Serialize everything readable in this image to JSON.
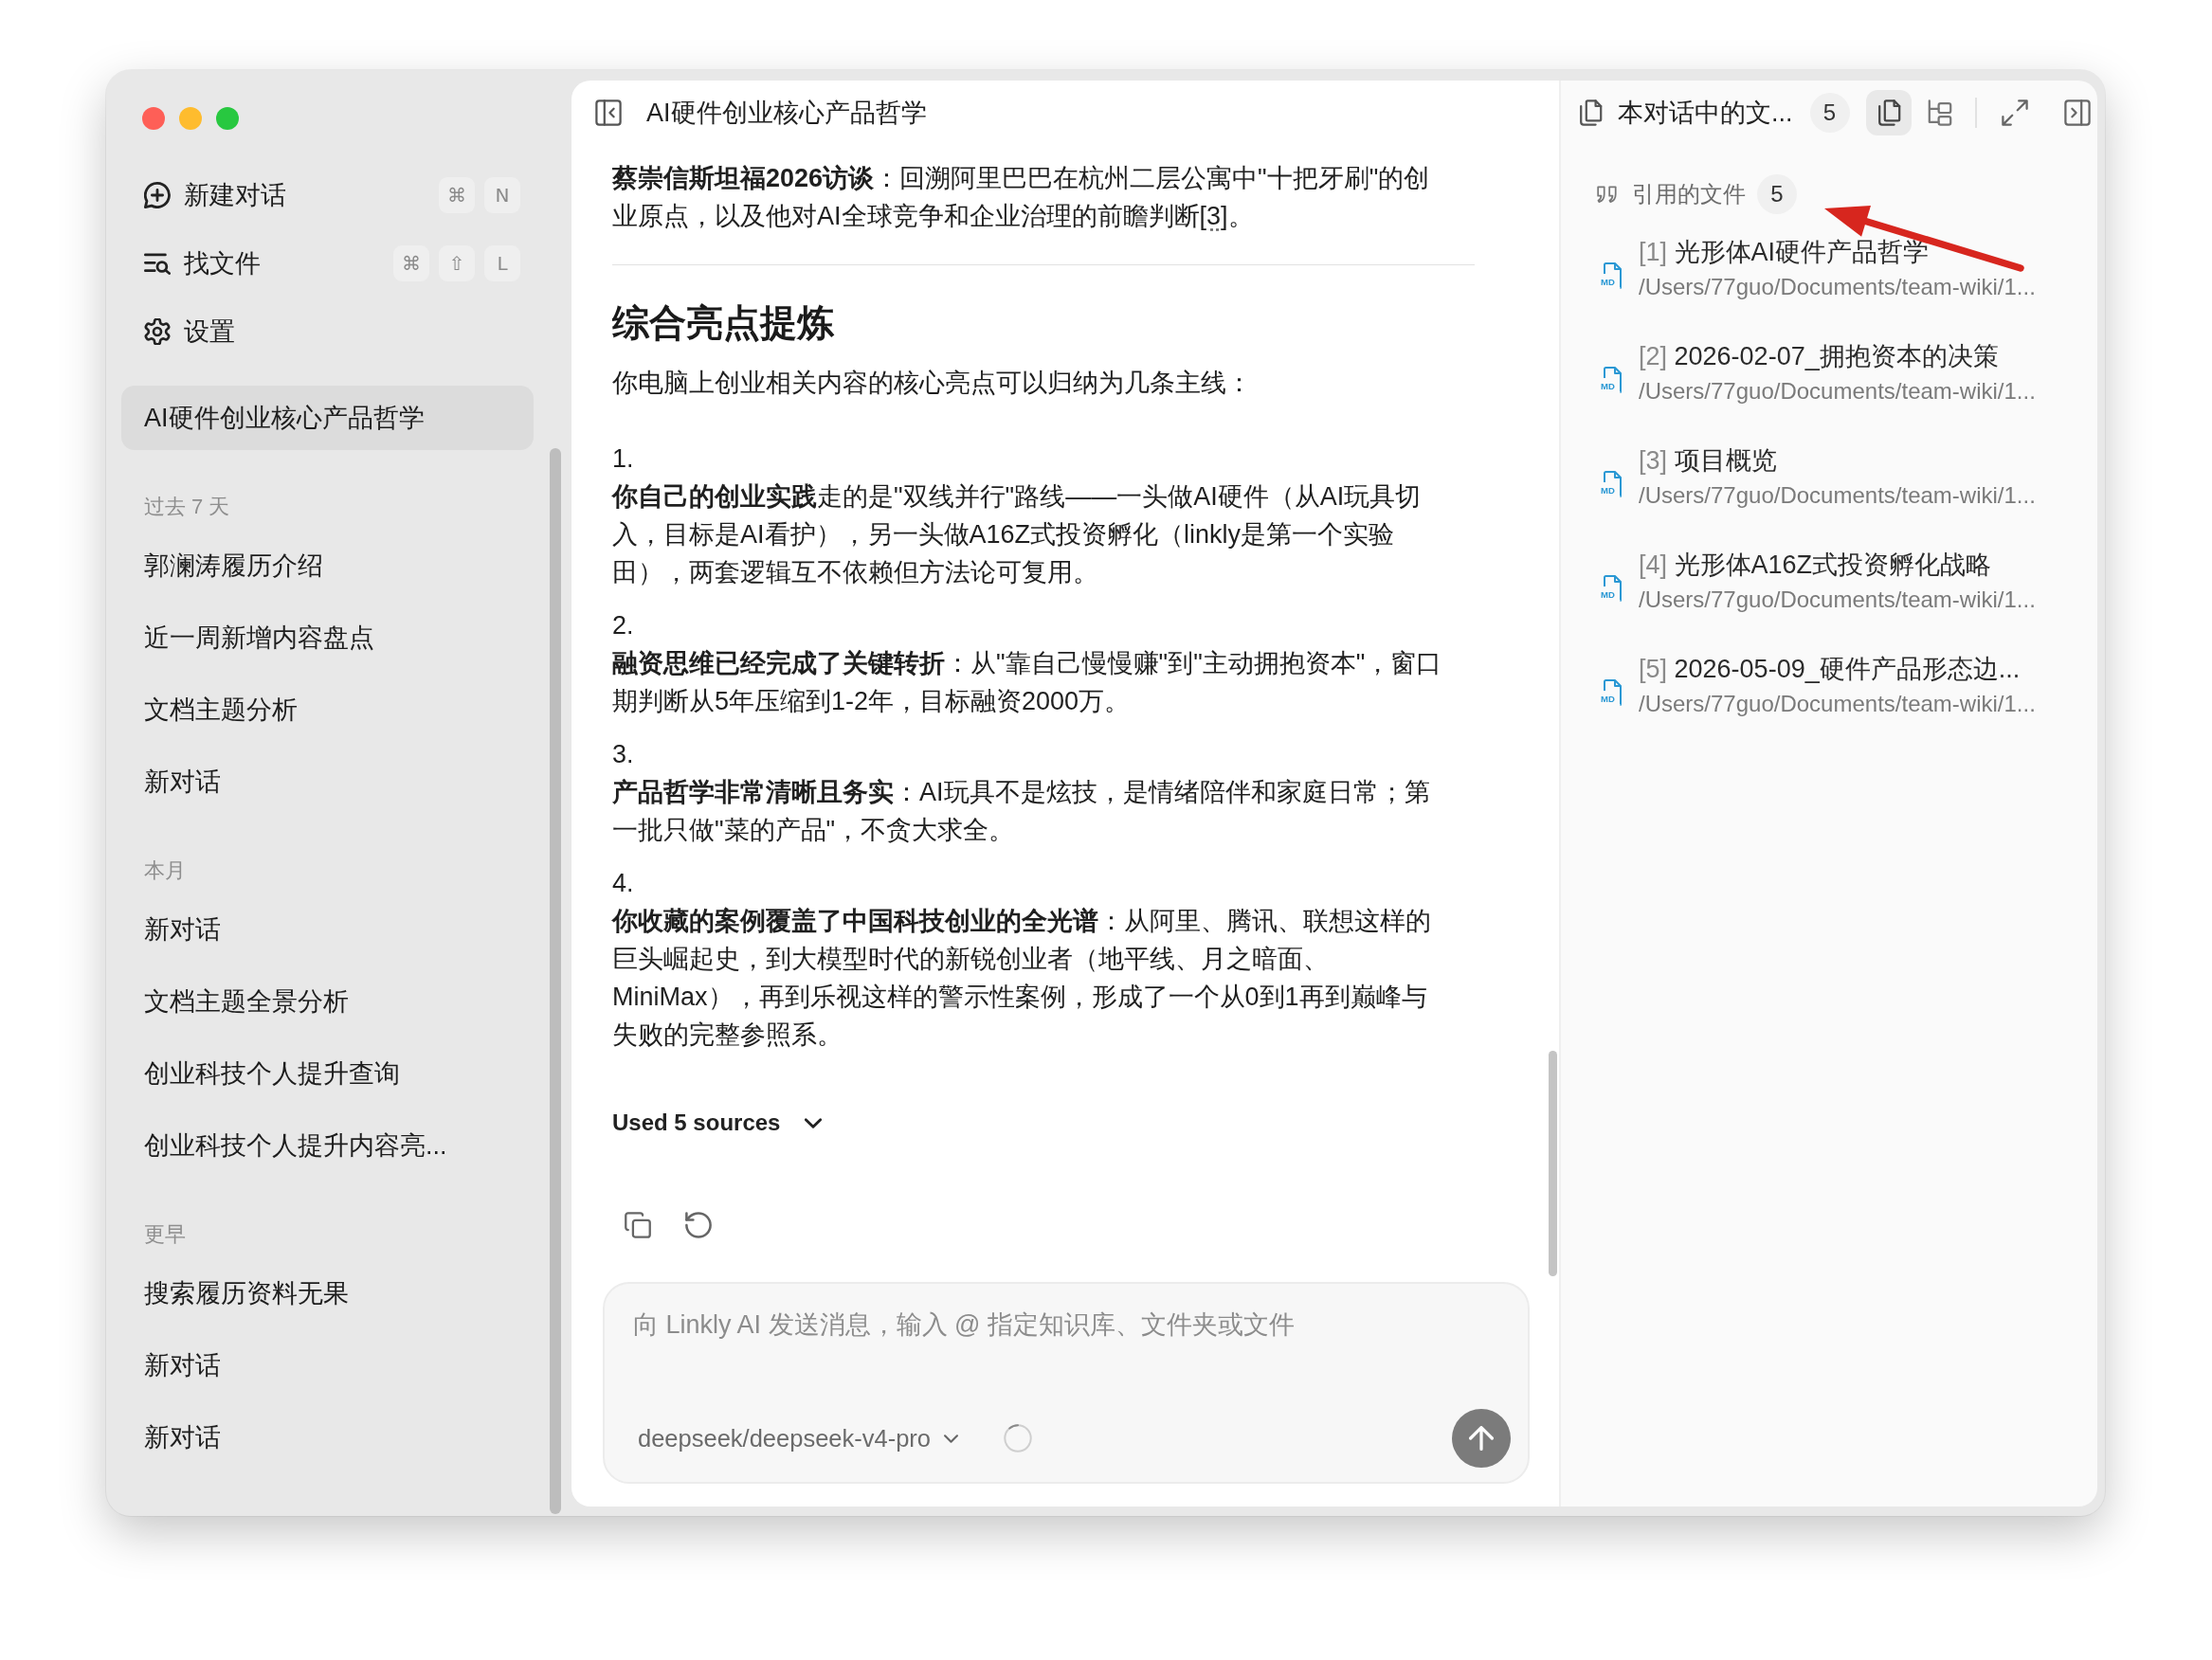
{
  "sidebar": {
    "actions": [
      {
        "kind": "new-chat",
        "label": "新建对话",
        "keys": [
          "⌘",
          "N"
        ]
      },
      {
        "kind": "find-files",
        "label": "找文件",
        "keys": [
          "⌘",
          "⇧",
          "L"
        ]
      },
      {
        "kind": "settings",
        "label": "设置"
      }
    ],
    "groups": [
      {
        "items": [
          {
            "title": "AI硬件创业核心产品哲学",
            "selected": true
          }
        ]
      },
      {
        "heading": "过去 7 天",
        "items": [
          {
            "title": "郭澜涛履历介绍",
            "selected": false
          },
          {
            "title": "近一周新增内容盘点",
            "selected": false
          },
          {
            "title": "文档主题分析",
            "selected": false
          },
          {
            "title": "新对话",
            "selected": false
          }
        ]
      },
      {
        "heading": "本月",
        "items": [
          {
            "title": "新对话",
            "selected": false
          },
          {
            "title": "文档主题全景分析",
            "selected": false
          },
          {
            "title": "创业科技个人提升查询",
            "selected": false
          },
          {
            "title": "创业科技个人提升内容亮...",
            "selected": false
          }
        ]
      },
      {
        "heading": "更早",
        "items": [
          {
            "title": "搜索履历资料无果",
            "selected": false
          },
          {
            "title": "新对话",
            "selected": false
          },
          {
            "title": "新对话",
            "selected": false
          }
        ]
      }
    ]
  },
  "chat": {
    "title": "AI硬件创业核心产品哲学",
    "intro_paragraph": {
      "text": "**蔡崇信斯坦福2026访谈**：回溯阿里巴巴在杭州二层公寓中\"十把牙刷\"的创业原点，以及他对AI全球竞争和企业治理的前瞻判断",
      "citation": "[3]",
      "end": "。"
    },
    "heading": "综合亮点提炼",
    "lead": "你电脑上创业相关内容的核心亮点可以归纳为几条主线：",
    "points": [
      {
        "number": "1.",
        "text": "**你自己的创业实践**走的是\"双线并行\"路线——一头做AI硬件（从AI玩具切入，目标是AI看护），另一头做A16Z式投资孵化（linkly是第一个实验田），两套逻辑互不依赖但方法论可复用。"
      },
      {
        "number": "2.",
        "text": "**融资思维已经完成了关键转折**：从\"靠自己慢慢赚\"到\"主动拥抱资本\"，窗口期判断从5年压缩到1-2年，目标融资2000万。"
      },
      {
        "number": "3.",
        "text": "**产品哲学非常清晰且务实**：AI玩具不是炫技，是情绪陪伴和家庭日常；第一批只做\"菜的产品\"，不贪大求全。"
      },
      {
        "number": "4.",
        "text": "**你收藏的案例覆盖了中国科技创业的全光谱**：从阿里、腾讯、联想这样的巨头崛起史，到大模型时代的新锐创业者（地平线、月之暗面、MiniMax），再到乐视这样的警示性案例，形成了一个从0到1再到巅峰与失败的完整参照系。"
      }
    ],
    "sources": {
      "label": "Used 5 sources",
      "expanded": false
    }
  },
  "composer": {
    "placeholder": "向 Linkly AI 发送消息，输入 @ 指定知识库、文件夹或文件",
    "model": "deepseek/deepseek-v4-pro",
    "loading": true
  },
  "panel": {
    "title": "本对话中的文...",
    "count": "5",
    "views": [
      {
        "kind": "files",
        "selected": true
      },
      {
        "kind": "tree",
        "selected": false
      }
    ],
    "section": {
      "title": "引用的文件",
      "count": "5",
      "files": [
        {
          "type": "MD",
          "index": "[1]",
          "title": "光形体AI硬件产品哲学",
          "path": "/Users/77guo/Documents/team-wiki/1..."
        },
        {
          "type": "MD",
          "index": "[2]",
          "title": "2026-02-07_拥抱资本的决策",
          "path": "/Users/77guo/Documents/team-wiki/1..."
        },
        {
          "type": "MD",
          "index": "[3]",
          "title": "项目概览",
          "path": "/Users/77guo/Documents/team-wiki/1..."
        },
        {
          "type": "MD",
          "index": "[4]",
          "title": "光形体A16Z式投资孵化战略",
          "path": "/Users/77guo/Documents/team-wiki/1..."
        },
        {
          "type": "MD",
          "index": "[5]",
          "title": "2026-05-09_硬件产品形态边...",
          "path": "/Users/77guo/Documents/team-wiki/1..."
        }
      ]
    }
  },
  "annotation": {
    "kind": "arrow"
  }
}
